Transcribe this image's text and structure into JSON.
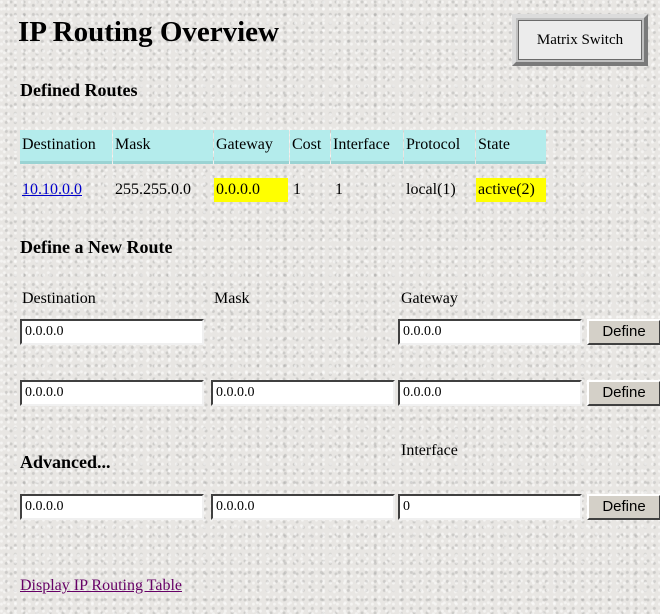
{
  "page": {
    "title": "IP Routing Overview",
    "matrix_switch_label": "Matrix Switch",
    "footer_link": "Display IP Routing Table"
  },
  "defined_routes": {
    "heading": "Defined Routes",
    "columns": [
      "Destination",
      "Mask",
      "Gateway",
      "Cost",
      "Interface",
      "Protocol",
      "State"
    ],
    "rows": [
      {
        "destination": "10.10.0.0",
        "mask": "255.255.0.0",
        "gateway": "0.0.0.0",
        "cost": "1",
        "interface": "1",
        "protocol": "local(1)",
        "state": "active(2)"
      }
    ]
  },
  "new_route": {
    "heading": "Define a New Route",
    "labels": {
      "destination": "Destination",
      "mask": "Mask",
      "gateway": "Gateway",
      "interface": "Interface"
    },
    "row1": {
      "destination": "0.0.0.0",
      "gateway": "0.0.0.0"
    },
    "row2": {
      "destination": "0.0.0.0",
      "mask": "0.0.0.0",
      "gateway": "0.0.0.0"
    },
    "define_label": "Define"
  },
  "advanced": {
    "heading": "Advanced...",
    "destination": "0.0.0.0",
    "mask": "0.0.0.0",
    "interface": "0"
  },
  "colors": {
    "header_bg": "#b4ecec",
    "highlight": "#ffff00",
    "link": "#0000cc",
    "visited_link": "#660066"
  }
}
